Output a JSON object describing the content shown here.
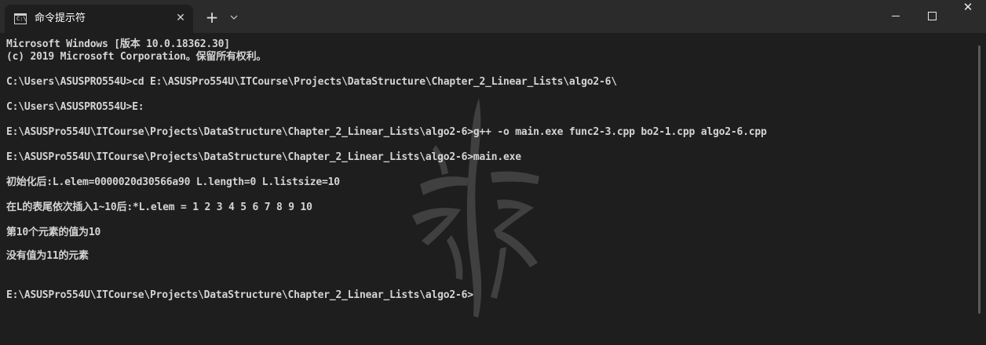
{
  "window": {
    "tab_title": "命令提示符",
    "tab_icon": "cmd-icon",
    "tab_close": "✕",
    "new_tab": "+",
    "dropdown": "⌄",
    "close_glyph": "✕"
  },
  "terminal": {
    "lines": [
      "Microsoft Windows [版本 10.0.18362.30]",
      "(c) 2019 Microsoft Corporation。保留所有权利。",
      "C:\\Users\\ASUSPRO554U>cd E:\\ASUSPro554U\\ITCourse\\Projects\\DataStructure\\Chapter_2_Linear_Lists\\algo2-6\\",
      "C:\\Users\\ASUSPRO554U>E:",
      "E:\\ASUSPro554U\\ITCourse\\Projects\\DataStructure\\Chapter_2_Linear_Lists\\algo2-6>g++ -o main.exe func2-3.cpp bo2-1.cpp algo2-6.cpp",
      "E:\\ASUSPro554U\\ITCourse\\Projects\\DataStructure\\Chapter_2_Linear_Lists\\algo2-6>main.exe",
      "初始化后:L.elem=0000020d30566a90 L.length=0 L.listsize=10",
      "在L的表尾依次插入1~10后:*L.elem = 1 2 3 4 5 6 7 8 9 10",
      "第10个元素的值为10",
      "没有值为11的元素",
      "E:\\ASUSPro554U\\ITCourse\\Projects\\DataStructure\\Chapter_2_Linear_Lists\\algo2-6>"
    ]
  },
  "colors": {
    "background": "#1e1e1e",
    "titlebar": "#2b2b2b",
    "text": "#d4d4d4"
  }
}
